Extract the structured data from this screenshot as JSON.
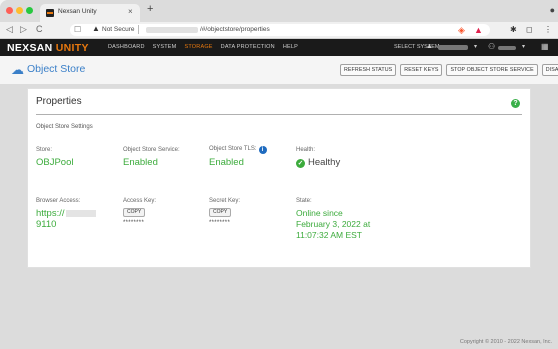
{
  "browser": {
    "tab_title": "Nexsan Unity",
    "tab_close": "×",
    "new_tab": "+",
    "menu_glyph": "●",
    "nav_back": "◁",
    "nav_forward": "▷",
    "nav_reload": "C",
    "bookmark": "☐",
    "warning_glyph": "▲",
    "security_label": "Not Secure",
    "url_path": "/#/objectstore/properties",
    "brave_glyph": "◈",
    "rewards_glyph": "▲",
    "ext1_glyph": "✱",
    "ext2_glyph": "◻",
    "ext3_glyph": "⋮"
  },
  "topnav": {
    "logo_main": "NEXSAN",
    "logo_accent": "UNITY",
    "links": [
      "DASHBOARD",
      "SYSTEM",
      "STORAGE",
      "DATA PROTECTION",
      "HELP"
    ],
    "active_link": "STORAGE",
    "select_system_label": "SELECT SYSTEM",
    "system_icon": "▲",
    "caret": "▾",
    "user_icon": "⚇",
    "calendar_icon": "▦"
  },
  "page": {
    "icon": "☁",
    "title": "Object Store",
    "actions": [
      "REFRESH STATUS",
      "RESET KEYS",
      "STOP OBJECT STORE SERVICE",
      "DISABLE TLS"
    ]
  },
  "panel": {
    "title": "Properties",
    "help_glyph": "?",
    "settings_label": "Object Store Settings",
    "store_label": "Store:",
    "store_value": "OBJPool",
    "service_label": "Object Store Service:",
    "service_value": "Enabled",
    "tls_label": "Object Store TLS:",
    "tls_info_glyph": "i",
    "tls_value": "Enabled",
    "health_label": "Health:",
    "health_check_glyph": "✓",
    "health_value": "Healthy",
    "browser_access_label": "Browser Access:",
    "browser_access_prefix": "https://",
    "browser_access_suffix": "9110",
    "access_key_label": "Access Key:",
    "copy_label": "COPY",
    "access_key_mask": "********",
    "secret_key_label": "Secret Key:",
    "secret_key_mask": "********",
    "state_label": "State:",
    "state_line1": "Online since",
    "state_line2": "February 3, 2022 at",
    "state_line3": "11:07:32 AM EST"
  },
  "footer": {
    "copyright": "Copyright © 2010 - 2022   Nexsan, Inc."
  },
  "colors": {
    "accent_orange": "#e8780e",
    "link_blue": "#3a7fc8",
    "ok_green": "#3cab3c",
    "nav_bg": "#1a1a1a"
  }
}
